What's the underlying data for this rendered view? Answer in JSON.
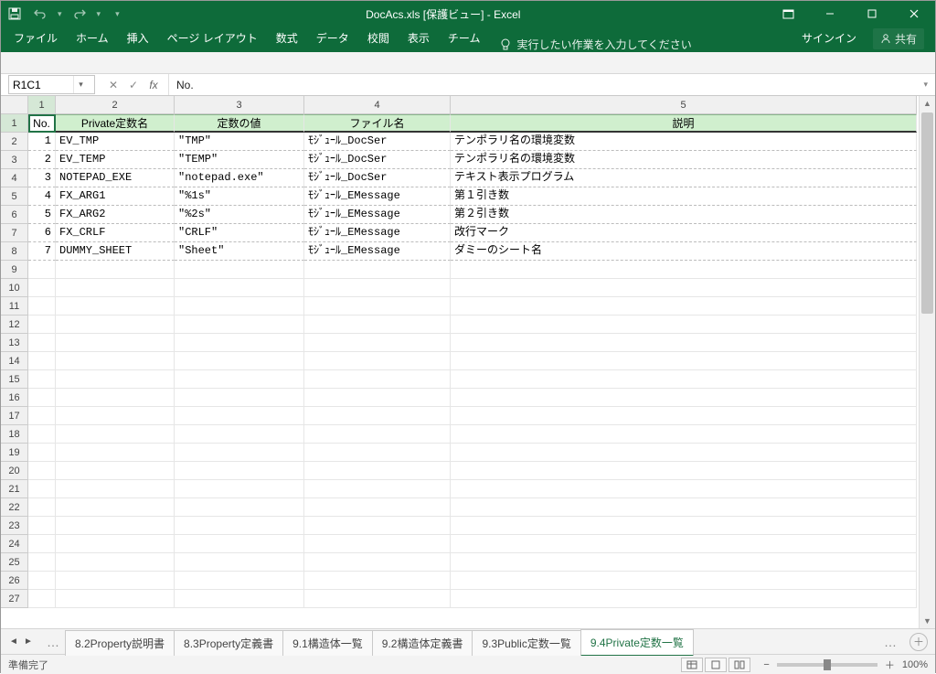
{
  "window": {
    "title": "DocAcs.xls  [保護ビュー] - Excel",
    "signin": "サインイン",
    "share": "共有"
  },
  "ribbon": {
    "tabs": [
      "ファイル",
      "ホーム",
      "挿入",
      "ページ レイアウト",
      "数式",
      "データ",
      "校閲",
      "表示",
      "チーム"
    ],
    "tellme_label": "実行したい作業を入力してください"
  },
  "namebox": {
    "value": "R1C1"
  },
  "formula": {
    "value": "No."
  },
  "columns": {
    "widths": [
      30,
      130,
      142,
      160,
      510
    ],
    "labels": [
      "1",
      "2",
      "3",
      "4",
      "5"
    ]
  },
  "header_row": [
    "No.",
    "Private定数名",
    "定数の値",
    "ファイル名",
    "説明"
  ],
  "data_rows": [
    {
      "no": "1",
      "name": "EV_TMP",
      "value": "\"TMP\"",
      "file": "ﾓｼﾞｭｰﾙ_DocSer",
      "desc": "テンポラリ名の環境変数"
    },
    {
      "no": "2",
      "name": "EV_TEMP",
      "value": "\"TEMP\"",
      "file": "ﾓｼﾞｭｰﾙ_DocSer",
      "desc": "テンポラリ名の環境変数"
    },
    {
      "no": "3",
      "name": "NOTEPAD_EXE",
      "value": "\"notepad.exe\"",
      "file": "ﾓｼﾞｭｰﾙ_DocSer",
      "desc": "テキスト表示プログラム"
    },
    {
      "no": "4",
      "name": "FX_ARG1",
      "value": "\"%1s\"",
      "file": "ﾓｼﾞｭｰﾙ_EMessage",
      "desc": "第１引き数"
    },
    {
      "no": "5",
      "name": "FX_ARG2",
      "value": "\"%2s\"",
      "file": "ﾓｼﾞｭｰﾙ_EMessage",
      "desc": "第２引き数"
    },
    {
      "no": "6",
      "name": "FX_CRLF",
      "value": "\"CRLF\"",
      "file": "ﾓｼﾞｭｰﾙ_EMessage",
      "desc": "改行マーク"
    },
    {
      "no": "7",
      "name": "DUMMY_SHEET",
      "value": "\"Sheet\"",
      "file": "ﾓｼﾞｭｰﾙ_EMessage",
      "desc": "ダミーのシート名"
    }
  ],
  "total_visible_rows": 27,
  "sheet_tabs": {
    "inactive": [
      "8.2Property説明書",
      "8.3Property定義書",
      "9.1構造体一覧",
      "9.2構造体定義書",
      "9.3Public定数一覧"
    ],
    "active": "9.4Private定数一覧"
  },
  "status": {
    "ready": "準備完了",
    "zoom": "100%"
  }
}
